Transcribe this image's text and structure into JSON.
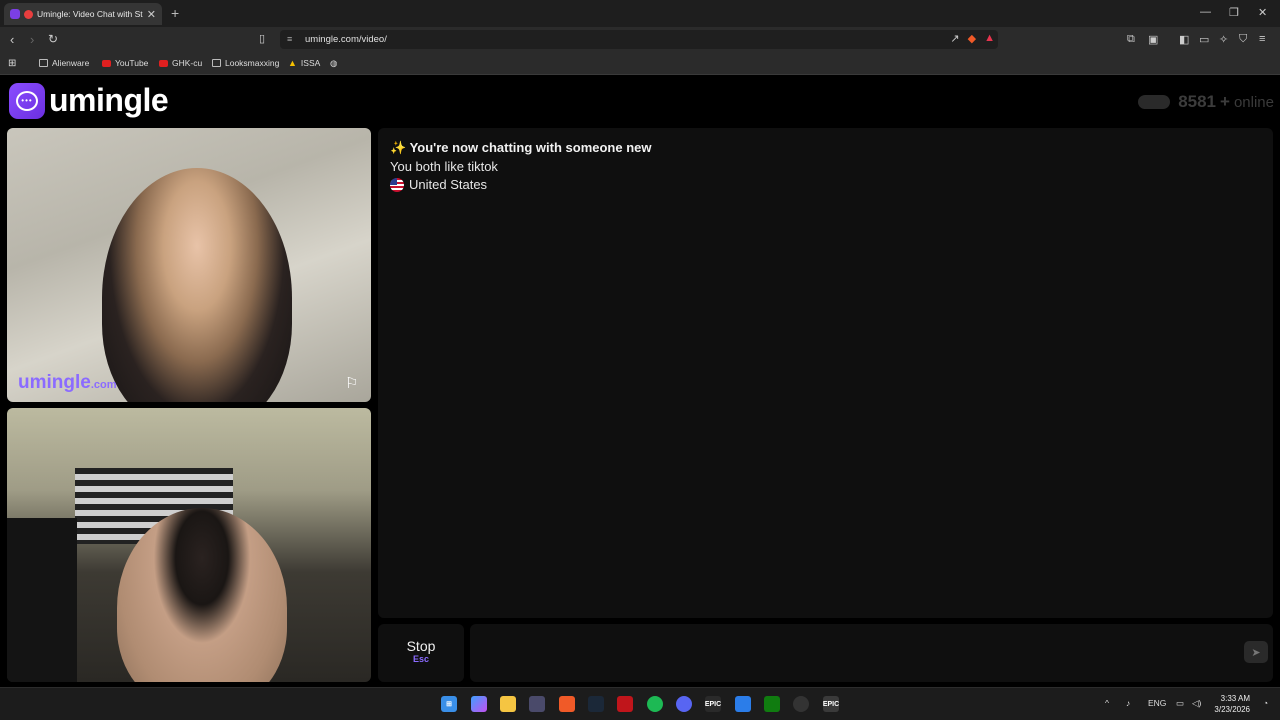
{
  "browser": {
    "tab_title": "Umingle: Video Chat with Strangers",
    "url": "umingle.com/video/",
    "bookmarks": [
      "Alienware",
      "YouTube",
      "GHK-cu",
      "Looksmaxxing",
      "ISSA"
    ]
  },
  "site": {
    "logo_text": "umingle",
    "online_count": "8581",
    "online_plus": "+",
    "online_label": "online"
  },
  "video": {
    "watermark_main": "umingle",
    "watermark_domain": ".com"
  },
  "chat": {
    "headline": "✨ You're now chatting with someone new",
    "common_interest": "You both like tiktok",
    "country": "United States"
  },
  "controls": {
    "stop_label": "Stop",
    "stop_shortcut": "Esc",
    "message_placeholder": "",
    "send_icon": "send-icon"
  },
  "taskbar": {
    "language": "ENG",
    "time": "3:33 AM",
    "date": "3/23/2026"
  },
  "colors": {
    "accent": "#8b6bff",
    "logo_gradient_start": "#8a4dff",
    "logo_gradient_end": "#6b2fe0",
    "panel_bg": "#0f0f0f"
  }
}
